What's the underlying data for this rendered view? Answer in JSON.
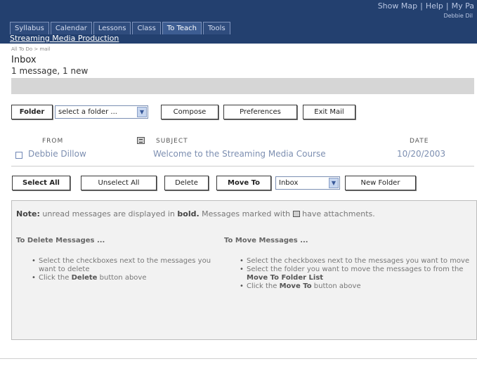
{
  "top_links": [
    "Show Map",
    "Help",
    "My Pa"
  ],
  "top_sub": "Debbie Dil",
  "tabs": [
    "Syllabus",
    "Calendar",
    "Lessons",
    "Class",
    "To Teach",
    "Tools"
  ],
  "active_tab": "To Teach",
  "course_title": "Streaming Media Production",
  "breadcrumb": "All To Do > mail",
  "inbox": {
    "title": "Inbox",
    "count": "1 message, 1 new"
  },
  "toolbar1": {
    "folder_label": "Folder",
    "folder_select": "select a folder ...",
    "compose": "Compose",
    "preferences": "Preferences",
    "exit_mail": "Exit Mail"
  },
  "columns": {
    "from": "FROM",
    "subject": "SUBJECT",
    "date": "DATE"
  },
  "messages": [
    {
      "from": "Debbie Dillow",
      "subject": "Welcome to the Streaming Media Course",
      "date": "10/20/2003"
    }
  ],
  "toolbar2": {
    "select_all": "Select All",
    "unselect_all": "Unselect All",
    "delete": "Delete",
    "move_to": "Move To",
    "move_select": "Inbox",
    "new_folder": "New Folder"
  },
  "note": {
    "label": "Note:",
    "text_a": "unread messages are displayed in",
    "bold_word": "bold.",
    "text_b": "Messages marked with",
    "text_c": "have attachments."
  },
  "delete_help": {
    "heading": "To Delete Messages ...",
    "line1": "Select the checkboxes next to the messages you want to delete",
    "line2_pre": "Click the",
    "line2_bold": "Delete",
    "line2_post": "button above"
  },
  "move_help": {
    "heading": "To Move Messages ...",
    "line1": "Select the checkboxes next to the messages you want to move",
    "line2_pre": "Select the folder you want to move the messages to from the",
    "line2_bold": "Move To Folder List",
    "line3_pre": "Click the",
    "line3_bold": "Move To",
    "line3_post": "button above"
  },
  "colors": {
    "header_bg": "#23406f",
    "link_muted": "#7d8fb1",
    "note_bg": "#f2f2f2"
  }
}
